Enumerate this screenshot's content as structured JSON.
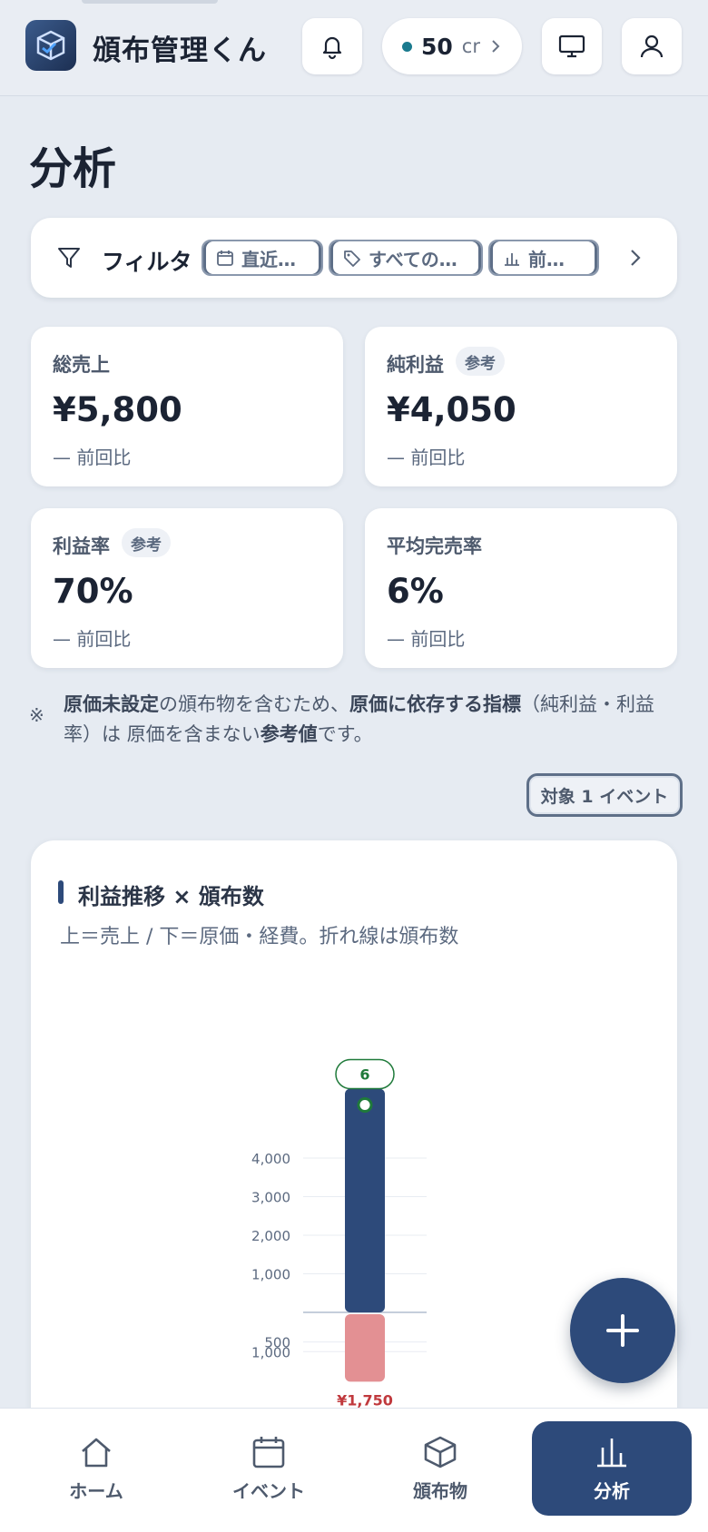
{
  "header": {
    "app_title": "頒布管理くん",
    "credits": {
      "value": "50",
      "unit": "cr"
    },
    "icons": [
      "bell-icon",
      "monitor-icon",
      "user-icon"
    ]
  },
  "page": {
    "title": "分析"
  },
  "filter": {
    "label": "フィルタ",
    "chips": [
      {
        "label": "直近…",
        "icon": "calendar-icon"
      },
      {
        "label": "すべての…",
        "icon": "tag-icon"
      },
      {
        "label": "前…",
        "icon": "chart-icon"
      }
    ]
  },
  "kpis": [
    {
      "label": "総売上",
      "badge": "",
      "value": "¥5,800",
      "compare": "— 前回比"
    },
    {
      "label": "純利益",
      "badge": "参考",
      "value": "¥4,050",
      "compare": "— 前回比"
    },
    {
      "label": "利益率",
      "badge": "参考",
      "value": "70%",
      "compare": "— 前回比"
    },
    {
      "label": "平均完売率",
      "badge": "",
      "value": "6%",
      "compare": "— 前回比"
    }
  ],
  "note": {
    "mark": "※",
    "part1": "原価未設定",
    "part2": "の頒布物を含むため、",
    "part3": "原価に依存する指標",
    "part4": "（純利益・利益率）は 原価を含まない",
    "part5": "参考値",
    "part6": "です。"
  },
  "target": {
    "label": "対象 1 イベント"
  },
  "chart": {
    "title": "利益推移 × 頒布数",
    "subtitle": "上＝売上 / 下＝原価・経費。折れ線は頒布数"
  },
  "chart_data": {
    "type": "bar",
    "title": "利益推移 × 頒布数",
    "positive_ticks": [
      "1,000",
      "2,000",
      "3,000",
      "4,000"
    ],
    "negative_ticks": [
      "500",
      "1,000"
    ],
    "series": [
      {
        "values": [
          5800
        ],
        "color": "#2d4a7a"
      },
      {
        "values": [
          -1750
        ],
        "color": "#e39093",
        "label": "¥1,750"
      }
    ],
    "line": {
      "values": [
        6
      ],
      "color": "#1f7a3a",
      "label": "6"
    }
  },
  "fab": {
    "icon": "plus-icon"
  },
  "nav": [
    {
      "label": "ホーム",
      "icon": "home-icon",
      "active": false
    },
    {
      "label": "イベント",
      "icon": "calendar-icon",
      "active": false
    },
    {
      "label": "頒布物",
      "icon": "box-icon",
      "active": false
    },
    {
      "label": "分析",
      "icon": "analytics-icon",
      "active": true
    }
  ]
}
